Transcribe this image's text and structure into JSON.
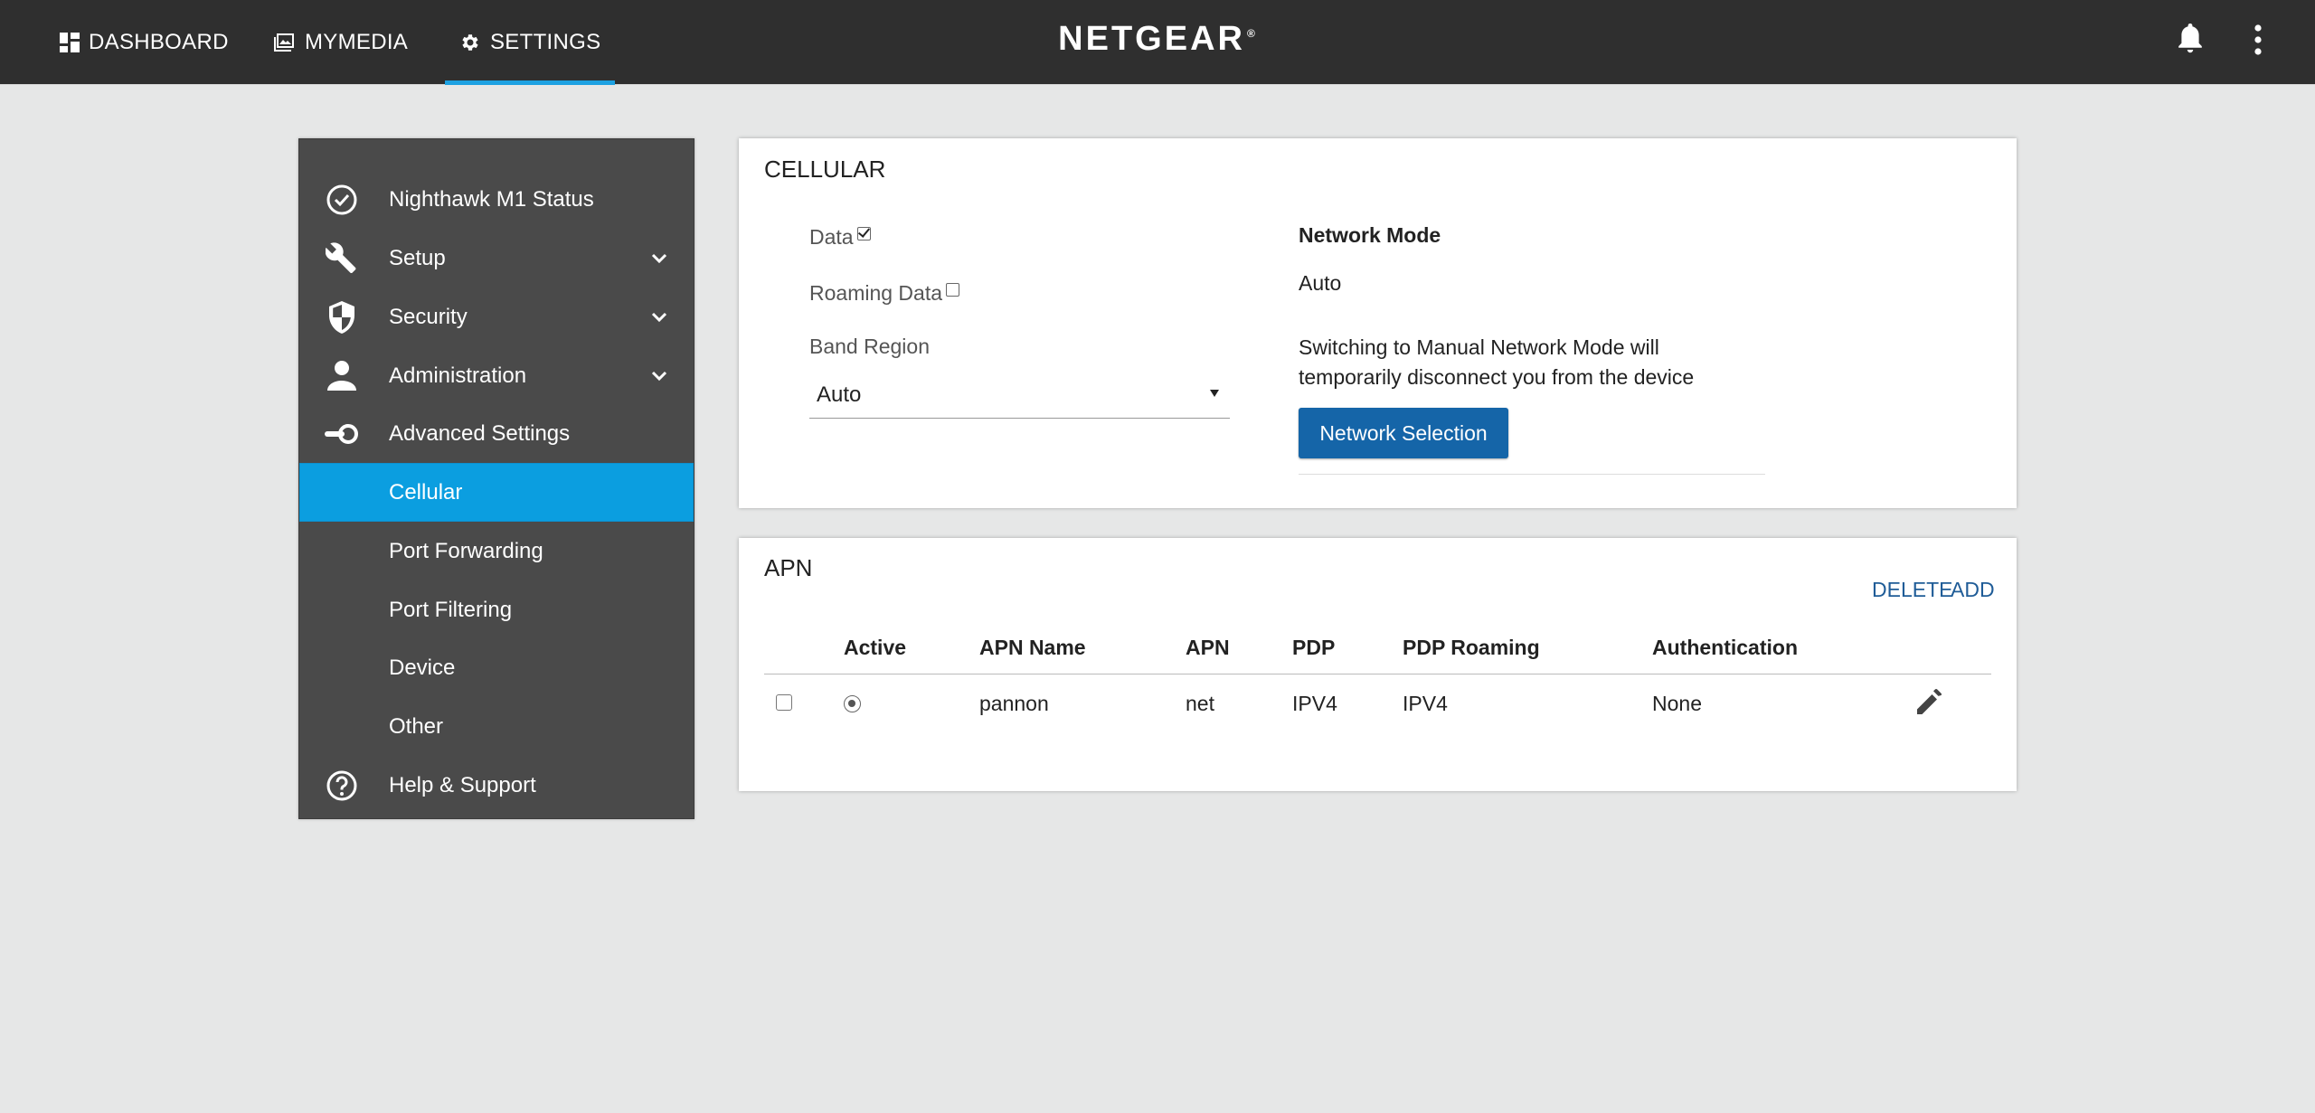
{
  "nav": {
    "tabs": [
      {
        "label": "DASHBOARD",
        "icon": "dashboard-icon"
      },
      {
        "label": "MYMEDIA",
        "icon": "media-icon"
      },
      {
        "label": "SETTINGS",
        "icon": "gear-icon"
      }
    ],
    "brand": "NETGEAR",
    "brand_mark": "®",
    "accent": "#1da1e2"
  },
  "sidebar": {
    "items": [
      {
        "label": "Nighthawk M1 Status",
        "icon": "check-circle-icon"
      },
      {
        "label": "Setup",
        "icon": "wrench-icon"
      },
      {
        "label": "Security",
        "icon": "shield-icon"
      },
      {
        "label": "Administration",
        "icon": "person-icon"
      },
      {
        "label": "Advanced Settings",
        "icon": "toggle-icon"
      },
      {
        "label": "Cellular"
      },
      {
        "label": "Port Forwarding"
      },
      {
        "label": "Port Filtering"
      },
      {
        "label": "Device"
      },
      {
        "label": "Other"
      },
      {
        "label": "Help & Support",
        "icon": "help-circle-icon"
      }
    ],
    "active_color": "#0b9ee0"
  },
  "cellular": {
    "title": "CELLULAR",
    "data_label": "Data",
    "roaming_label": "Roaming Data",
    "band_region_label": "Band Region",
    "band_region_value": "Auto",
    "network_mode_label": "Network Mode",
    "network_mode_value": "Auto",
    "warning_line1": "Switching to Manual Network Mode will",
    "warning_line2": "temporarily disconnect you from the device",
    "network_selection_button": "Network Selection"
  },
  "apn": {
    "title": "APN",
    "delete_label": "DELETE",
    "add_label": "ADD",
    "columns": [
      "Active",
      "APN Name",
      "APN",
      "PDP",
      "PDP Roaming",
      "Authentication"
    ],
    "rows": [
      {
        "apn_name": "pannon",
        "apn": "net",
        "pdp": "IPV4",
        "pdp_roaming": "IPV4",
        "authentication": "None"
      }
    ]
  }
}
